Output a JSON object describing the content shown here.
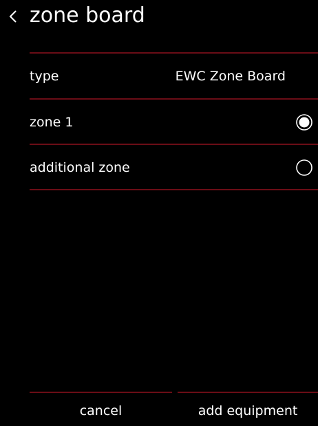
{
  "header": {
    "back_icon": "chevron-left-icon",
    "title": "zone board"
  },
  "rows": [
    {
      "label": "type",
      "value": "EWC Zone Board"
    },
    {
      "label": "zone 1",
      "selected": true
    },
    {
      "label": "additional zone",
      "selected": false
    }
  ],
  "footer": {
    "cancel_label": "cancel",
    "add_label": "add equipment"
  },
  "colors": {
    "background": "#000000",
    "divider": "#6b0d16",
    "text": "#ffffff"
  }
}
